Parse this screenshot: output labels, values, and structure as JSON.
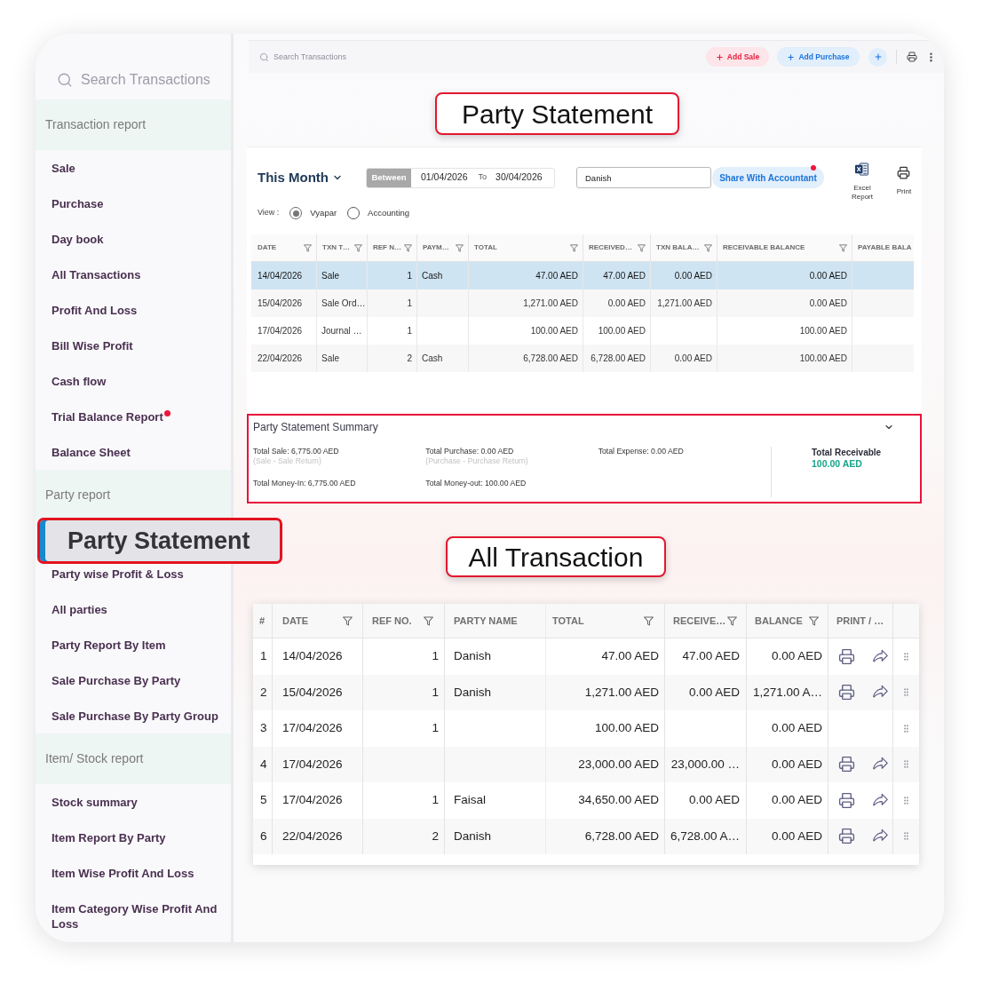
{
  "sidebar": {
    "search": {
      "placeholder": "Search Transactions"
    },
    "sections": [
      {
        "title": "Transaction report",
        "items": [
          {
            "label": "Sale",
            "selected": false,
            "notification": false
          },
          {
            "label": "Purchase",
            "selected": false,
            "notification": false
          },
          {
            "label": "Day book",
            "selected": false,
            "notification": false
          },
          {
            "label": "All Transactions",
            "selected": false,
            "notification": false
          },
          {
            "label": "Profit And Loss",
            "selected": false,
            "notification": false
          },
          {
            "label": "Bill Wise Profit",
            "selected": false,
            "notification": false
          },
          {
            "label": "Cash flow",
            "selected": false,
            "notification": false
          },
          {
            "label": "Trial Balance Report",
            "selected": false,
            "notification": true
          },
          {
            "label": "Balance Sheet",
            "selected": false,
            "notification": false
          }
        ]
      },
      {
        "title": "Party report",
        "items": [
          {
            "label": "Party Statement",
            "selected": true,
            "notification": false
          },
          {
            "label": "Party wise Profit & Loss",
            "selected": false,
            "notification": false
          },
          {
            "label": "All parties",
            "selected": false,
            "notification": false
          },
          {
            "label": "Party Report By Item",
            "selected": false,
            "notification": false
          },
          {
            "label": "Sale Purchase By Party",
            "selected": false,
            "notification": false
          },
          {
            "label": "Sale Purchase By Party Group",
            "selected": false,
            "notification": false
          }
        ]
      },
      {
        "title": "Item/ Stock report",
        "items": [
          {
            "label": "Stock summary",
            "selected": false,
            "notification": false
          },
          {
            "label": "Item Report By Party",
            "selected": false,
            "notification": false
          },
          {
            "label": "Item Wise Profit And Loss",
            "selected": false,
            "notification": false
          },
          {
            "label": "Item Category Wise Profit And Loss",
            "selected": false,
            "notification": false
          }
        ]
      }
    ]
  },
  "toolbar": {
    "search": {
      "placeholder": "Search Transactions"
    },
    "buttons": [
      {
        "kind": "sale",
        "label": "Add Sale"
      },
      {
        "kind": "purchase",
        "label": "Add Purchase"
      }
    ]
  },
  "party_statement": {
    "callout": "Party Statement",
    "period": "This Month",
    "date_range": {
      "label": "Between",
      "from": "01/04/2026",
      "separator": "To",
      "to": "30/04/2026"
    },
    "party": {
      "value": "Danish"
    },
    "share_button": {
      "label": "Share With Accountant",
      "notification": true
    },
    "exports": [
      {
        "kind": "excel",
        "label": "Excel Report"
      },
      {
        "kind": "print",
        "label": "Print"
      }
    ],
    "view": {
      "label": "View :",
      "options": [
        {
          "label": "Vyapar",
          "selected": true
        },
        {
          "label": "Accounting",
          "selected": false
        }
      ]
    },
    "table": {
      "columns": [
        {
          "label": "DATE",
          "kind": "text",
          "filter": true
        },
        {
          "label": "TXN T…",
          "kind": "text",
          "filter": true
        },
        {
          "label": "REF N…",
          "kind": "number",
          "filter": true
        },
        {
          "label": "PAYM…",
          "kind": "text",
          "filter": true
        },
        {
          "label": "TOTAL",
          "kind": "number",
          "filter": true
        },
        {
          "label": "RECEIVED…",
          "kind": "number",
          "filter": true
        },
        {
          "label": "TXN BALA…",
          "kind": "number",
          "filter": true
        },
        {
          "label": "RECEIVABLE BALANCE",
          "kind": "number",
          "filter": true
        },
        {
          "label": "PAYABLE BALA",
          "kind": "number",
          "filter": false
        }
      ],
      "rows": [
        {
          "selected": true,
          "cells": [
            "14/04/2026",
            "Sale",
            "1",
            "Cash",
            "47.00 AED",
            "47.00 AED",
            "0.00 AED",
            "0.00 AED",
            null
          ]
        },
        {
          "selected": false,
          "cells": [
            "15/04/2026",
            "Sale Ord…",
            "1",
            null,
            "1,271.00 AED",
            "0.00 AED",
            "1,271.00 AED",
            "0.00 AED",
            null
          ]
        },
        {
          "selected": false,
          "cells": [
            "17/04/2026",
            "Journal …",
            "1",
            null,
            "100.00 AED",
            "100.00 AED",
            null,
            "100.00 AED",
            null
          ]
        },
        {
          "selected": false,
          "cells": [
            "22/04/2026",
            "Sale",
            "2",
            "Cash",
            "6,728.00 AED",
            "6,728.00 AED",
            "0.00 AED",
            "100.00 AED",
            null
          ]
        }
      ]
    },
    "summary": {
      "title": "Party Statement Summary",
      "expanded": true,
      "items": [
        {
          "label": "Total Sale: 6,775.00 AED",
          "note": "(Sale - Sale Return)"
        },
        {
          "label": "Total Purchase: 0.00 AED",
          "note": "(Purchase - Purchase Return)"
        },
        {
          "label": "Total Expense: 0.00 AED"
        },
        {
          "label": "Total Money-In: 6,775.00 AED"
        },
        {
          "label": "Total Money-out: 100.00 AED"
        }
      ],
      "total": {
        "label": "Total Receivable",
        "value": "100.00 AED"
      }
    }
  },
  "all_transactions": {
    "callout": "All Transaction",
    "table": {
      "columns": [
        {
          "label": "#",
          "kind": "text",
          "filter": false
        },
        {
          "label": "DATE",
          "kind": "text",
          "filter": true
        },
        {
          "label": "REF NO.",
          "kind": "number",
          "filter": true
        },
        {
          "label": "PARTY NAME",
          "kind": "text",
          "filter": false
        },
        {
          "label": "TOTAL",
          "kind": "number",
          "filter": true
        },
        {
          "label": "RECEIVE…",
          "kind": "number",
          "filter": true
        },
        {
          "label": "BALANCE",
          "kind": "number",
          "filter": true
        },
        {
          "label": "PRINT / …",
          "kind": "actions",
          "filter": false
        }
      ],
      "rows": [
        {
          "cells": [
            "1",
            "14/04/2026",
            "1",
            "Danish",
            "47.00 AED",
            "47.00 AED",
            "0.00 AED"
          ],
          "actions": true
        },
        {
          "cells": [
            "2",
            "15/04/2026",
            "1",
            "Danish",
            "1,271.00 AED",
            "0.00 AED",
            "1,271.00 A…"
          ],
          "actions": true
        },
        {
          "cells": [
            "3",
            "17/04/2026",
            "1",
            null,
            "100.00 AED",
            null,
            "0.00 AED"
          ],
          "actions": false
        },
        {
          "cells": [
            "4",
            "17/04/2026",
            null,
            null,
            "23,000.00 AED",
            "23,000.00 …",
            "0.00 AED"
          ],
          "actions": true
        },
        {
          "cells": [
            "5",
            "17/04/2026",
            "1",
            "Faisal",
            "34,650.00 AED",
            "0.00 AED",
            "0.00 AED"
          ],
          "actions": true
        },
        {
          "cells": [
            "6",
            "22/04/2026",
            "2",
            "Danish",
            "6,728.00 AED",
            "6,728.00 A…",
            "0.00 AED"
          ],
          "actions": true
        }
      ]
    }
  }
}
